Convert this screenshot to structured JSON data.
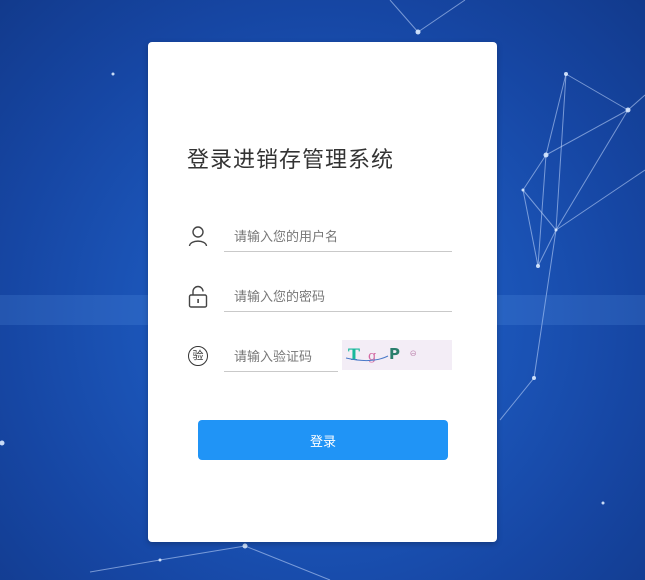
{
  "login": {
    "title": "登录进销存管理系统",
    "username_placeholder": "请输入您的用户名",
    "password_placeholder": "请输入您的密码",
    "captcha_placeholder": "请输入验证码",
    "captcha_icon_text": "验",
    "captcha_text": "TgPဓ",
    "login_button": "登录"
  },
  "icons": {
    "username": "user-icon",
    "password": "lock-icon",
    "captcha": "verify-icon"
  },
  "colors": {
    "background": "#1c57bb",
    "primary_button": "#2094f6",
    "card": "#ffffff"
  }
}
